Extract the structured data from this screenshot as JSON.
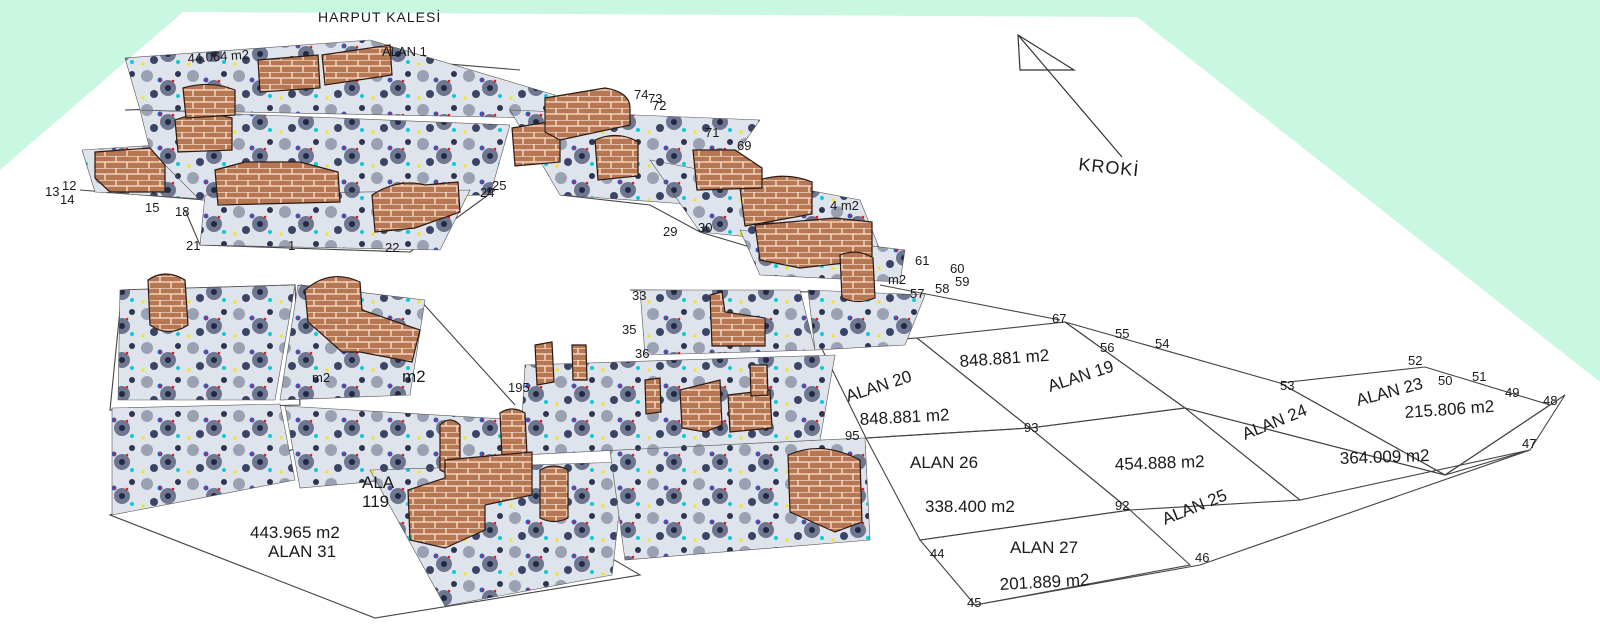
{
  "title": "HARPUT KALESİ",
  "kroki_label": "KROKİ",
  "colors": {
    "background": "#c9f7e1",
    "paper": "#ffffff",
    "wall": "#b77752",
    "mortar": "#fbe4d2"
  },
  "areas": [
    {
      "id": "alan1",
      "lines": [
        "ALAN 1"
      ]
    },
    {
      "id": "alan19",
      "lines": [
        "ALAN 19",
        "848.881 m2"
      ]
    },
    {
      "id": "alan20",
      "lines": [
        "ALAN 20",
        "848.881 m2"
      ]
    },
    {
      "id": "alan23",
      "lines": [
        "ALAN 23",
        "215.806 m2"
      ]
    },
    {
      "id": "alan24",
      "lines": [
        "ALAN 24",
        "364.009 m2"
      ]
    },
    {
      "id": "alan25",
      "lines": [
        "ALAN 25",
        "454.888 m2"
      ]
    },
    {
      "id": "alan26",
      "lines": [
        "ALAN 26",
        "338.400 m2"
      ]
    },
    {
      "id": "alan27",
      "lines": [
        "ALAN 27",
        "201.889 m2"
      ]
    },
    {
      "id": "alan31",
      "lines": [
        "ALAN 31",
        "443.965 m2"
      ]
    },
    {
      "id": "misc",
      "lines": [
        "44.064 m2",
        "ALA",
        "119",
        "m2",
        "m2",
        "4 m2",
        "m2"
      ]
    }
  ],
  "point_labels": [
    "1",
    "12",
    "13",
    "14",
    "15",
    "18",
    "21",
    "22",
    "24",
    "25",
    "29",
    "30",
    "33",
    "35",
    "36",
    "44",
    "45",
    "46",
    "47",
    "48",
    "49",
    "50",
    "51",
    "52",
    "53",
    "54",
    "55",
    "56",
    "57",
    "58",
    "59",
    "60",
    "61",
    "67",
    "69",
    "71",
    "72",
    "73",
    "74",
    "92",
    "93",
    "95",
    "195"
  ]
}
